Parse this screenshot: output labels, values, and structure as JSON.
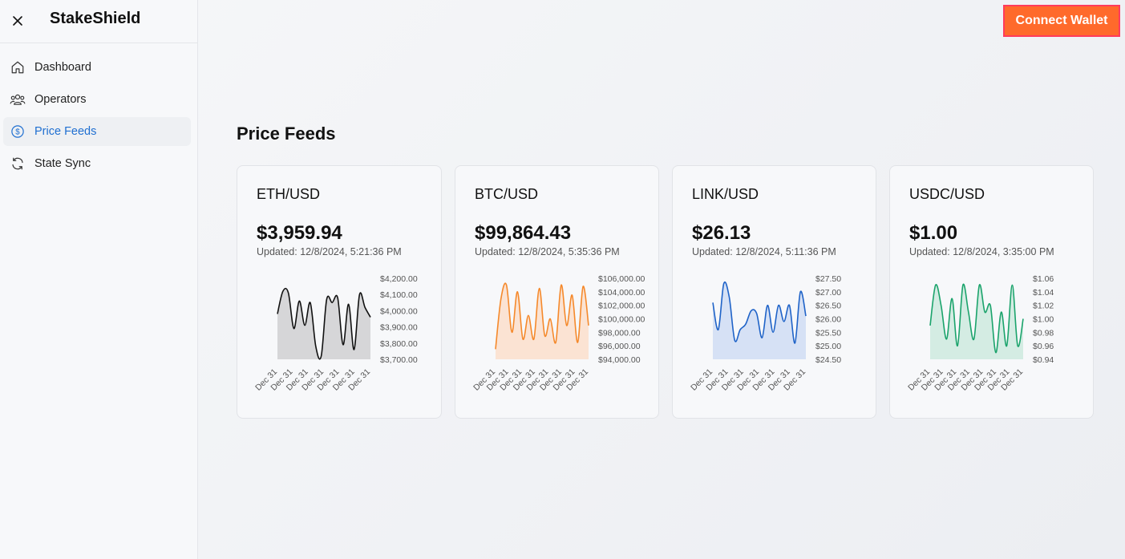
{
  "app": {
    "brand": "StakeShield"
  },
  "header": {
    "connect_label": "Connect Wallet"
  },
  "sidebar": {
    "items": [
      {
        "label": "Dashboard",
        "icon": "home-icon"
      },
      {
        "label": "Operators",
        "icon": "users-icon"
      },
      {
        "label": "Price Feeds",
        "icon": "dollar-circle-icon",
        "active": true
      },
      {
        "label": "State Sync",
        "icon": "refresh-icon"
      }
    ]
  },
  "main": {
    "title": "Price Feeds"
  },
  "colors": {
    "accent": "#ff6a2b",
    "active": "#1f6fd1"
  },
  "feeds": [
    {
      "pair": "ETH/USD",
      "price": "$3,959.94",
      "updated": "Updated: 12/8/2024, 5:21:36 PM"
    },
    {
      "pair": "BTC/USD",
      "price": "$99,864.43",
      "updated": "Updated: 12/8/2024, 5:35:36 PM"
    },
    {
      "pair": "LINK/USD",
      "price": "$26.13",
      "updated": "Updated: 12/8/2024, 5:11:36 PM"
    },
    {
      "pair": "USDC/USD",
      "price": "$1.00",
      "updated": "Updated: 12/8/2024, 3:35:00 PM"
    }
  ],
  "chart_data": [
    {
      "type": "area",
      "series_name": "ETH/USD",
      "color": "#111111",
      "fill": "#d6d6d8",
      "y_ticks": [
        "$4,200.00",
        "$4,100.00",
        "$4,000.00",
        "$3,900.00",
        "$3,800.00",
        "$3,700.00"
      ],
      "ylim": [
        3700,
        4200
      ],
      "x_ticks": [
        "Dec 31",
        "Dec 31",
        "Dec 31",
        "Dec 31",
        "Dec 31",
        "Dec 31",
        "Dec 31"
      ],
      "values": [
        3980,
        4120,
        4110,
        3890,
        4060,
        3910,
        4050,
        3780,
        3720,
        4070,
        4050,
        4080,
        3790,
        4040,
        3760,
        4100,
        4020,
        3960
      ]
    },
    {
      "type": "area",
      "series_name": "BTC/USD",
      "color": "#f5892b",
      "fill": "#fbe3d3",
      "y_ticks": [
        "$106,000.00",
        "$104,000.00",
        "$102,000.00",
        "$100,000.00",
        "$98,000.00",
        "$96,000.00",
        "$94,000.00"
      ],
      "ylim": [
        94000,
        106000
      ],
      "x_ticks": [
        "Dec 31",
        "Dec 31",
        "Dec 31",
        "Dec 31",
        "Dec 31",
        "Dec 31",
        "Dec 31",
        "Dec 31"
      ],
      "values": [
        95500,
        103000,
        105000,
        98000,
        104000,
        97000,
        100500,
        97000,
        104500,
        97500,
        100000,
        96500,
        105000,
        99000,
        103500,
        96500,
        104800,
        99000
      ]
    },
    {
      "type": "area",
      "series_name": "LINK/USD",
      "color": "#1f63c8",
      "fill": "#d6e1f5",
      "y_ticks": [
        "$27.50",
        "$27.00",
        "$26.50",
        "$26.00",
        "$25.50",
        "$25.00",
        "$24.50"
      ],
      "ylim": [
        24.5,
        27.5
      ],
      "x_ticks": [
        "Dec 31",
        "Dec 31",
        "Dec 31",
        "Dec 31",
        "Dec 31",
        "Dec 31",
        "Dec 31"
      ],
      "values": [
        26.6,
        25.6,
        27.3,
        26.8,
        25.2,
        25.6,
        25.8,
        26.3,
        26.2,
        25.3,
        26.5,
        25.5,
        26.5,
        25.9,
        26.5,
        25.1,
        27.0,
        26.1
      ]
    },
    {
      "type": "area",
      "series_name": "USDC/USD",
      "color": "#1aa36b",
      "fill": "#d4ece3",
      "y_ticks": [
        "$1.06",
        "$1.04",
        "$1.02",
        "$1.00",
        "$0.98",
        "$0.96",
        "$0.94"
      ],
      "ylim": [
        0.94,
        1.06
      ],
      "x_ticks": [
        "Dec 31",
        "Dec 31",
        "Dec 31",
        "Dec 31",
        "Dec 31",
        "Dec 31",
        "Dec 31",
        "Dec 31"
      ],
      "values": [
        0.99,
        1.05,
        1.02,
        0.97,
        1.03,
        0.96,
        1.05,
        1.01,
        0.97,
        1.05,
        1.01,
        1.02,
        0.95,
        1.01,
        0.96,
        1.05,
        0.96,
        1.0
      ]
    }
  ]
}
